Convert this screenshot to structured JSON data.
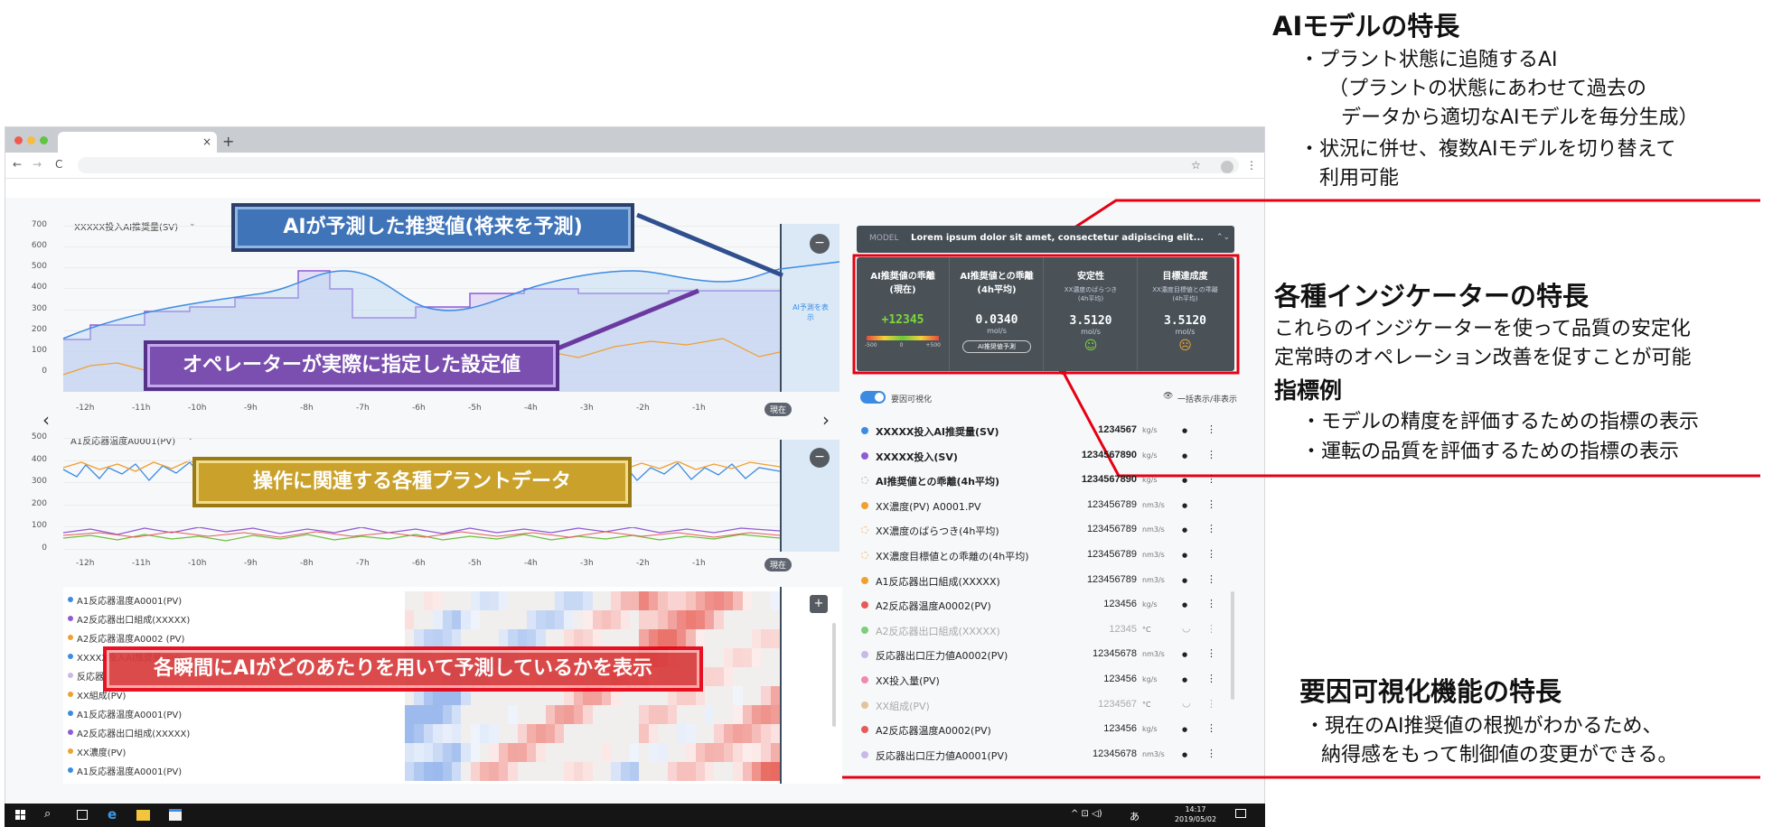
{
  "browser": {
    "tab_close": "×",
    "tab_new": "+",
    "nav_back": "←",
    "nav_forward": "→",
    "nav_reload": "C"
  },
  "chart1": {
    "label": "XXXXX投入AI推奨量(SV)",
    "yticks": [
      "700",
      "600",
      "500",
      "400",
      "300",
      "200",
      "100",
      "0"
    ],
    "xticks": [
      "-12h",
      "-11h",
      "-10h",
      "-9h",
      "-8h",
      "-7h",
      "-6h",
      "-5h",
      "-4h",
      "-3h",
      "-2h",
      "-1h"
    ],
    "now": "現在",
    "future_label": "AI予測を表示",
    "minus": "−"
  },
  "chart2": {
    "label": "A1反応器温度A0001(PV)",
    "yticks": [
      "500",
      "400",
      "300",
      "200",
      "100",
      "0"
    ],
    "xticks": [
      "-12h",
      "-11h",
      "-10h",
      "-9h",
      "-8h",
      "-7h",
      "-6h",
      "-5h",
      "-4h",
      "-3h",
      "-2h",
      "-1h"
    ],
    "now": "現在",
    "minus": "−"
  },
  "arrows": {
    "left": "‹",
    "right": "›"
  },
  "annotations": {
    "ai_predicted": "AIが予測した推奨値(将来を予測)",
    "operator_setpoint": "オペレーターが実際に指定した設定値",
    "plant_data": "操作に関連する各種プラントデータ",
    "heatmap_note": "各瞬間にAIがどのあたりを用いて予測しているかを表示"
  },
  "heatmap": {
    "plus": "+",
    "rows": [
      {
        "label": "A1反応器温度A0001(PV)",
        "color": "#3c8be3"
      },
      {
        "label": "A2反応器出口組成(XXXXX)",
        "color": "#8f5ad8"
      },
      {
        "label": "A2反応器温度A0002 (PV)",
        "color": "#f0a030"
      },
      {
        "label": "XXXXX投入AI推奨量(SV)",
        "color": "#3c8be3"
      },
      {
        "label": "反応器",
        "color": "#c9b8e8"
      },
      {
        "label": "XX組成(PV)",
        "color": "#f0a030"
      },
      {
        "label": "A1反応器温度A0001(PV)",
        "color": "#3c8be3"
      },
      {
        "label": "A2反応器出口組成(XXXXX)",
        "color": "#8f5ad8"
      },
      {
        "label": "XX濃度(PV)",
        "color": "#f0a030"
      },
      {
        "label": "A1反応器温度A0001(PV)",
        "color": "#3c8be3"
      }
    ]
  },
  "model": {
    "tag": "MODEL",
    "name": "Lorem ipsum dolor sit amet, consectetur adipiscing elit...",
    "chevron": "⌃⌄"
  },
  "indicators": [
    {
      "title": "AI推奨値の乖離\n(現在)",
      "sub": "",
      "value": "+12345",
      "unit": "",
      "gauge_labels": [
        "-500",
        "0",
        "+500"
      ]
    },
    {
      "title": "AI推奨値との乖離\n(4h平均)",
      "sub": "",
      "value": "0.0340",
      "unit": "mol/s",
      "button": "AI推奨値予測"
    },
    {
      "title": "安定性",
      "sub": "XX濃度のばらつき\n(4h平均)",
      "value": "3.5120",
      "unit": "mol/s",
      "face": "☺"
    },
    {
      "title": "目標達成度",
      "sub": "XX濃度目標値との乖離\n(4h平均)",
      "value": "3.5120",
      "unit": "mol/s",
      "face": "☹"
    }
  ],
  "controls": {
    "toggle_label": "要因可視化",
    "show_all": "一括表示/非表示"
  },
  "variables": [
    {
      "name": "XXXXX投入AI推奨量(SV)",
      "value": "1234567",
      "unit": "kg/s",
      "color": "#3c8be3",
      "bold": true
    },
    {
      "name": "XXXXX投入(SV)",
      "value": "1234567890",
      "unit": "kg/s",
      "color": "#8f5ad8",
      "bold": true
    },
    {
      "name": "AI推奨値との乖離(4h平均)",
      "value": "1234567890",
      "unit": "kg/s",
      "color": "#c9b8e8",
      "bold": true
    },
    {
      "name": "XX濃度(PV) A0001.PV",
      "value": "123456789",
      "unit": "nm3/s",
      "color": "#f0a030",
      "bold": false
    },
    {
      "name": "XX濃度のばらつき(4h平均)",
      "value": "123456789",
      "unit": "nm3/s",
      "color": "#f5c780",
      "bold": false
    },
    {
      "name": "XX濃度目標値との乖離の(4h平均)",
      "value": "123456789",
      "unit": "nm3/s",
      "color": "#f5c780",
      "bold": false
    },
    {
      "name": "A1反応器出口組成(XXXXX)",
      "value": "123456789",
      "unit": "nm3/s",
      "color": "#f0a030",
      "bold": false
    },
    {
      "name": "A2反応器温度A0002(PV)",
      "value": "123456",
      "unit": "kg/s",
      "color": "#e85a5a",
      "bold": false
    },
    {
      "name": "A2反応器出口組成(XXXXX)",
      "value": "12345",
      "unit": "°C",
      "color": "#7ccf7c",
      "bold": false,
      "muted": true
    },
    {
      "name": "反応器出口圧力値A0002(PV)",
      "value": "12345678",
      "unit": "nm3/s",
      "color": "#c9b8e8",
      "bold": false
    },
    {
      "name": "XX投入量(PV)",
      "value": "123456",
      "unit": "kg/s",
      "color": "#f08aa8",
      "bold": false
    },
    {
      "name": "XX組成(PV)",
      "value": "1234567",
      "unit": "°C",
      "color": "#e2c39a",
      "bold": false,
      "muted": true
    },
    {
      "name": "A2反応器温度A0002(PV)",
      "value": "123456",
      "unit": "kg/s",
      "color": "#e85a5a",
      "bold": false
    },
    {
      "name": "反応器出口圧力値A0001(PV)",
      "value": "12345678",
      "unit": "nm3/s",
      "color": "#c9b8e8",
      "bold": false
    }
  ],
  "right_text": {
    "ai_heading": "AIモデルの特長",
    "ai_body": [
      "・プラント状態に追随するAI",
      "（プラントの状態にあわせて過去の",
      "データから適切なAIモデルを毎分生成）",
      "・状況に併せ、複数AIモデルを切り替えて",
      "利用可能"
    ],
    "ind_heading": "各種インジケーターの特長",
    "ind_body": [
      "これらのインジケーターを使って品質の安定化",
      "定常時のオペレーション改善を促すことが可能"
    ],
    "ind_subheading": "指標例",
    "ind_examples": [
      "・モデルの精度を評価するための指標の表示",
      "・運転の品質を評価するための指標の表示"
    ],
    "factor_heading": "要因可視化機能の特長",
    "factor_body": [
      "・現在のAI推奨値の根拠がわかるため、",
      "納得感をもって制御値の変更ができる。"
    ]
  },
  "taskbar": {
    "time": "14:17",
    "date": "2019/05/02",
    "ime": "あ"
  },
  "colors": {
    "accent": "#3c8be3",
    "annot_blue": "#3f74b8",
    "annot_purple": "#7a4fb0",
    "annot_gold": "#caa12a",
    "annot_red": "#d93c3c",
    "callout": "#e60012"
  }
}
